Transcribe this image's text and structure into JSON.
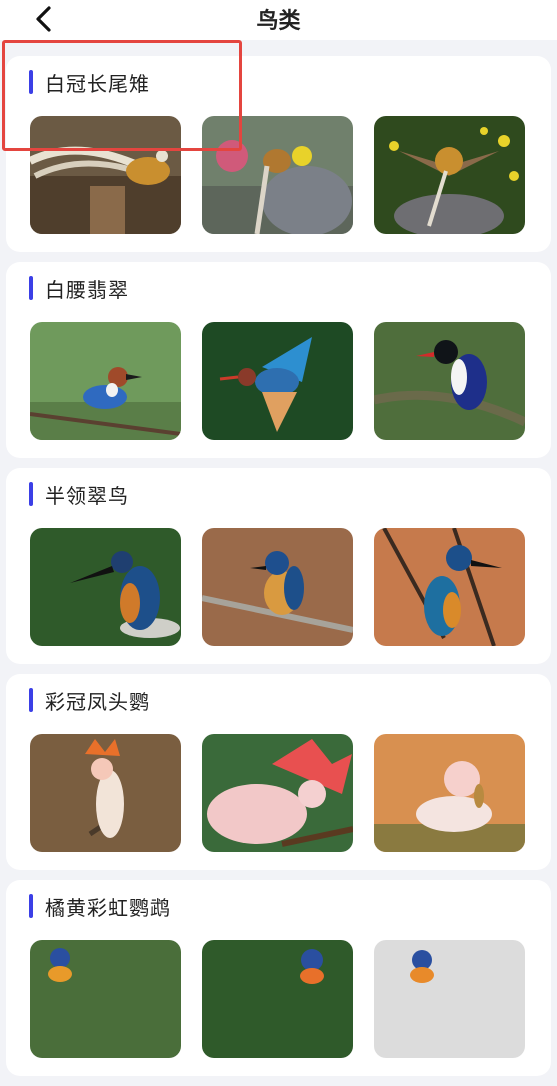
{
  "header": {
    "title": "鸟类",
    "back_icon": "chevron-left-icon"
  },
  "categories": [
    {
      "name": "白冠长尾雉",
      "images": [
        "pheasant-photo-1",
        "pheasant-photo-2",
        "pheasant-photo-3"
      ]
    },
    {
      "name": "白腰翡翠",
      "images": [
        "kingfisher-photo-1",
        "kingfisher-photo-2",
        "kingfisher-photo-3"
      ]
    },
    {
      "name": "半领翠鸟",
      "images": [
        "half-collared-kingfisher-photo-1",
        "half-collared-kingfisher-photo-2",
        "half-collared-kingfisher-photo-3"
      ]
    },
    {
      "name": "彩冠凤头鹦",
      "images": [
        "cockatoo-photo-1",
        "cockatoo-photo-2",
        "cockatoo-photo-3"
      ]
    },
    {
      "name": "橘黄彩虹鹦鹉",
      "images": [
        "lorikeet-photo-1",
        "lorikeet-photo-2",
        "lorikeet-photo-3"
      ]
    }
  ],
  "colors": {
    "accent": "#3b3fe6",
    "highlight": "#e4453f",
    "background": "#f2f3f7"
  }
}
